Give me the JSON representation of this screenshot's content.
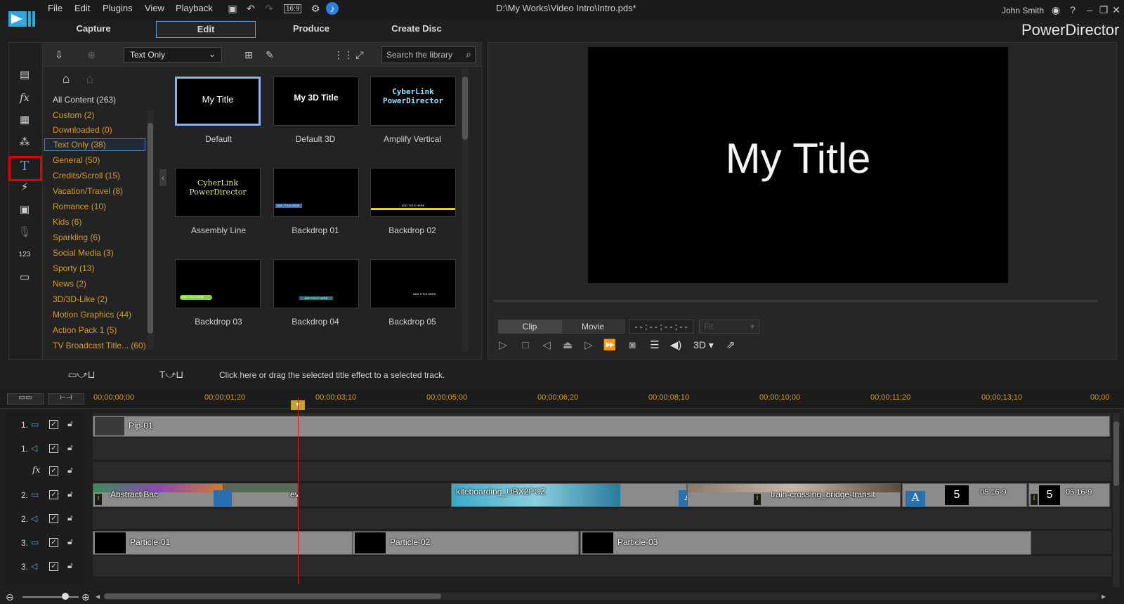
{
  "menu": [
    "File",
    "Edit",
    "Plugins",
    "View",
    "Playback"
  ],
  "doc_title": "D:\\My Works\\Video Intro\\Intro.pds*",
  "user": "John Smith",
  "brand": "PowerDirector",
  "aspect": "16:9",
  "mode_tabs": [
    "Capture",
    "Edit",
    "Produce",
    "Create Disc"
  ],
  "library": {
    "filter": "Text Only",
    "search_placeholder": "Search the library",
    "categories": [
      "All Content  (263)",
      "Custom  (2)",
      "Downloaded  (0)",
      "Text Only  (38)",
      "General  (50)",
      "Credits/Scroll  (15)",
      "Vacation/Travel  (8)",
      "Romance  (10)",
      "Kids  (6)",
      "Sparkling  (6)",
      "Social Media  (3)",
      "Sporty  (13)",
      "News  (2)",
      "3D/3D-Like  (2)",
      "Motion Graphics  (44)",
      "Action Pack 1  (5)",
      "TV Broadcast Title...  (60)"
    ],
    "thumbs": [
      {
        "label": "Default",
        "caption": "My Title"
      },
      {
        "label": "Default 3D",
        "caption": "My 3D Title"
      },
      {
        "label": "Amplify Vertical",
        "caption": "CyberLink PowerDirector"
      },
      {
        "label": "Assembly Line",
        "caption": "CyberLink PowerDirector"
      },
      {
        "label": "Backdrop 01",
        "caption": "ADD TITLE HERE"
      },
      {
        "label": "Backdrop 02",
        "caption": "ADD TITLE HERE"
      },
      {
        "label": "Backdrop 03",
        "caption": "ADD TITLE HERE"
      },
      {
        "label": "Backdrop 04",
        "caption": "ADD TITLE HERE"
      },
      {
        "label": "Backdrop 05",
        "caption": "ADD TITLE HERE"
      }
    ]
  },
  "preview": {
    "title_text": "My Title",
    "clip_btn": "Clip",
    "movie_btn": "Movie",
    "timecode": "- - ; - - ; - - ; - -",
    "fit": "Fit",
    "mode3d": "3D"
  },
  "timeline": {
    "hint": "Click here or drag the selected title effect to a selected track.",
    "ticks": [
      "00;00;00;00",
      "00;00;01;20",
      "00;00;03;10",
      "00;00;05;00",
      "00;00;06;20",
      "00;00;08;10",
      "00;00;10;00",
      "00;00;11;20",
      "00;00;13;10",
      "00;00"
    ],
    "tracks": [
      "1.",
      "1.",
      "",
      "2.",
      "2.",
      "3.",
      "3."
    ],
    "clips": {
      "pip": "Pip-01",
      "abstract": "Abstract Bac",
      "ev": "ev",
      "kite": "kiteboarding_UBX2PCZ",
      "train": "train-crossing_bridge-transit",
      "five_a": "5",
      "five_time_a": "05 16-9",
      "five_b": "5",
      "five_time_b": "05 16-9",
      "p1": "Particle-01",
      "p2": "Particle-02",
      "p3": "Particle-03",
      "a_glyph": "A",
      "info_glyph": "i"
    }
  }
}
